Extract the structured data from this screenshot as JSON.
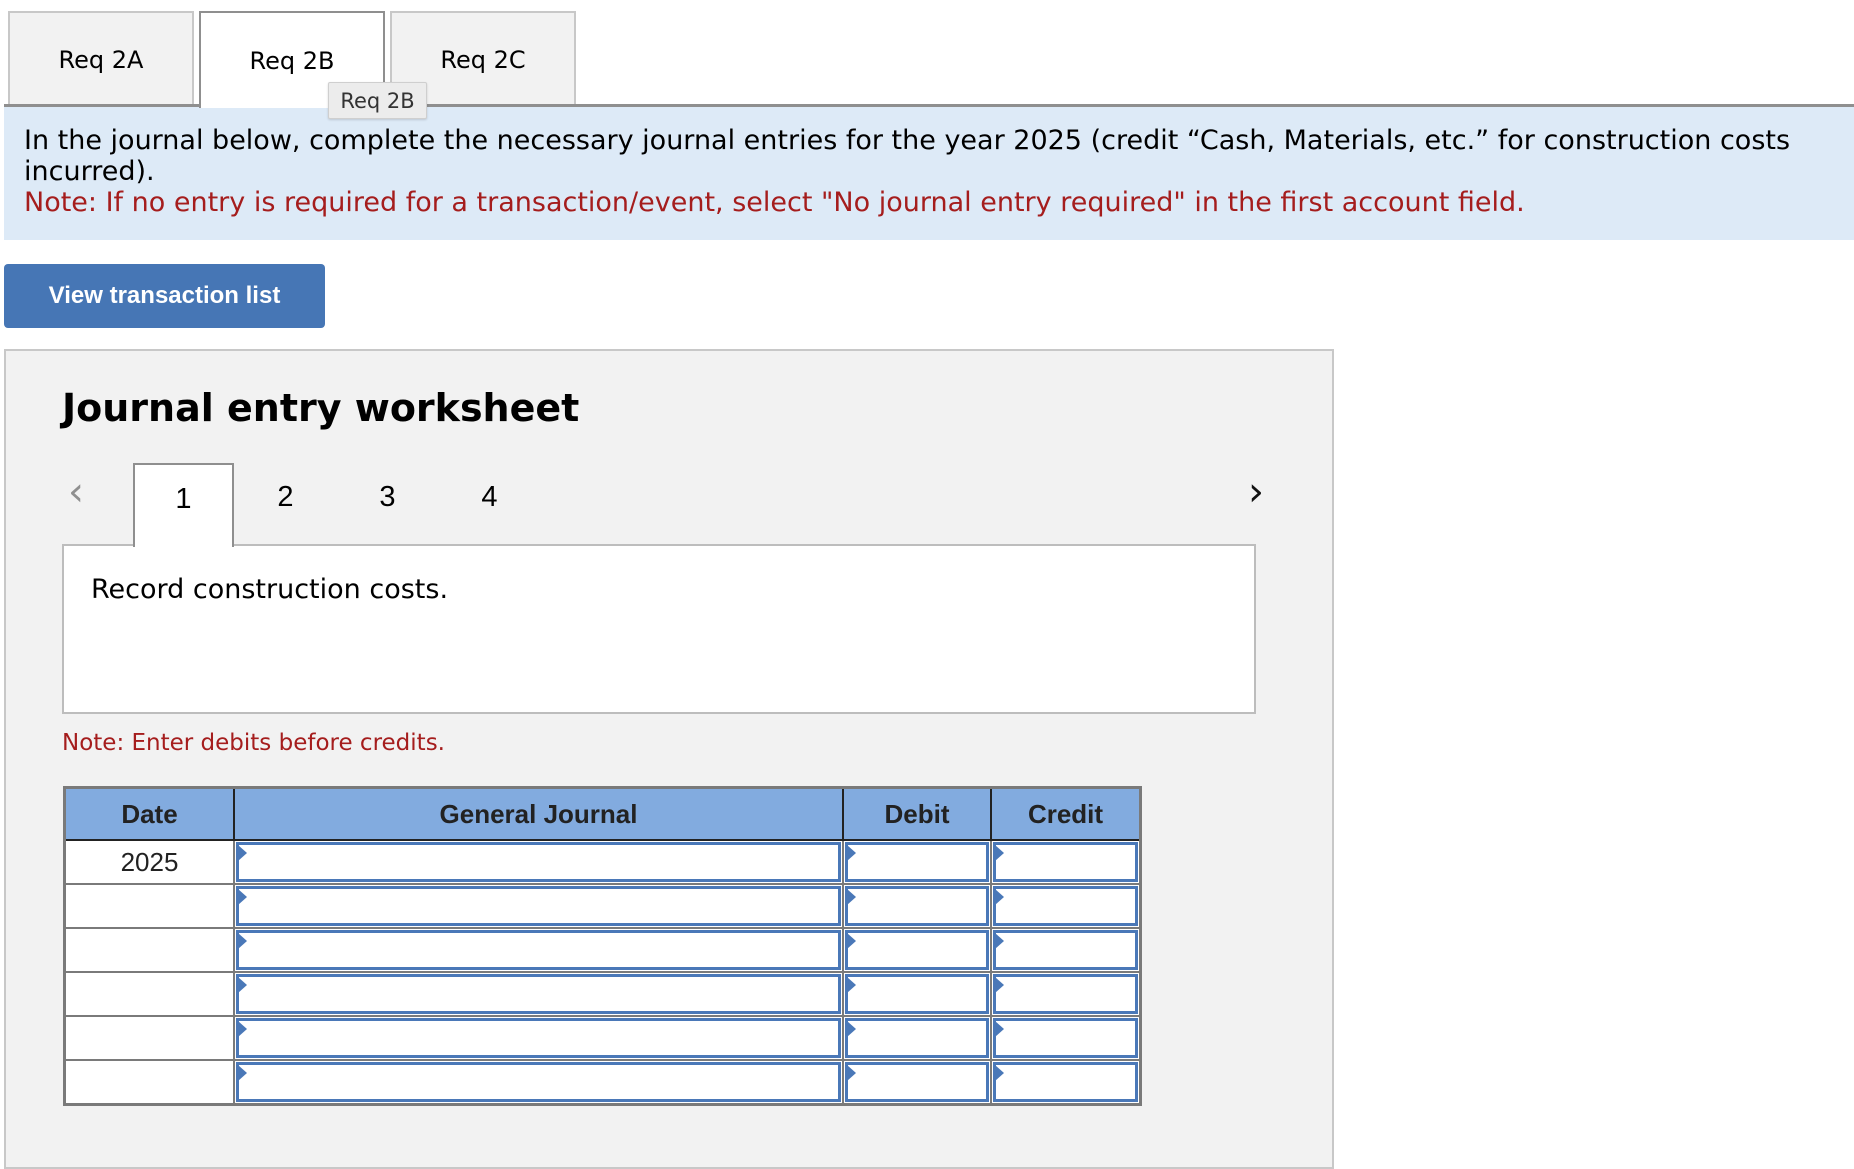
{
  "requirement_tabs": [
    {
      "label": "Req 2A",
      "active": false
    },
    {
      "label": "Req 2B",
      "active": true
    },
    {
      "label": "Req 2C",
      "active": false
    }
  ],
  "tooltip": "Req 2B",
  "instructions": {
    "text": "In the journal below, complete the necessary journal entries for the year 2025 (credit “Cash, Materials, etc.” for construction costs incurred).",
    "note": "Note: If no entry is required for a transaction/event, select \"No journal entry required\" in the first account field."
  },
  "view_transaction_button": "View transaction list",
  "worksheet": {
    "title": "Journal entry worksheet",
    "prev_icon": "chevron-left-icon",
    "next_icon": "chevron-right-icon",
    "steps": [
      {
        "label": "1",
        "active": true
      },
      {
        "label": "2",
        "active": false
      },
      {
        "label": "3",
        "active": false
      },
      {
        "label": "4",
        "active": false
      }
    ],
    "description": "Record construction costs.",
    "note": "Note: Enter debits before credits."
  },
  "journal": {
    "columns": [
      "Date",
      "General Journal",
      "Debit",
      "Credit"
    ],
    "rows": [
      {
        "date": "2025",
        "account": "",
        "debit": "",
        "credit": ""
      },
      {
        "date": "",
        "account": "",
        "debit": "",
        "credit": ""
      },
      {
        "date": "",
        "account": "",
        "debit": "",
        "credit": ""
      },
      {
        "date": "",
        "account": "",
        "debit": "",
        "credit": ""
      },
      {
        "date": "",
        "account": "",
        "debit": "",
        "credit": ""
      },
      {
        "date": "",
        "account": "",
        "debit": "",
        "credit": ""
      }
    ]
  },
  "colors": {
    "banner_bg": "#ddeaf7",
    "note_red": "#a51d1d",
    "button_blue": "#4676b5",
    "table_header": "#82abdf",
    "input_border": "#4a78b8"
  }
}
